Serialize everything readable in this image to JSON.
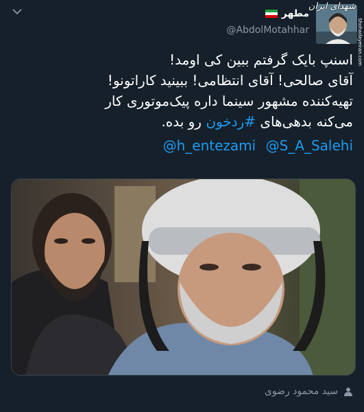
{
  "header": {
    "display_name": "مطهر",
    "handle": "@AbdolMotahhar",
    "flag_colors": [
      "#239f40",
      "#ffffff",
      "#da0000"
    ],
    "watermark": "شهدای ایران",
    "watermark_url": "Shohadayeiran.com"
  },
  "tweet": {
    "lines": [
      "اسنپ بایک گرفتم ببین کی اومد!",
      "آقای صالحی! آقای انتظامی! ببینید کاراتونو!",
      "تهیه‌کننده مشهور سینما داره پیک‌موتوری کار",
      "می‌کنه بدهی‌های",
      "رو بده."
    ],
    "hashtag": "#ردخون",
    "mentions": [
      "@h_entezami",
      "@S_A_Salehi"
    ]
  },
  "photo": {
    "description_icon": "selfie-photo"
  },
  "footer": {
    "attribution": "سید محمود رضوی",
    "icon": "user-icon"
  },
  "colors": {
    "background": "#15202b",
    "link": "#1d9bf0",
    "muted": "#8b98a5"
  }
}
